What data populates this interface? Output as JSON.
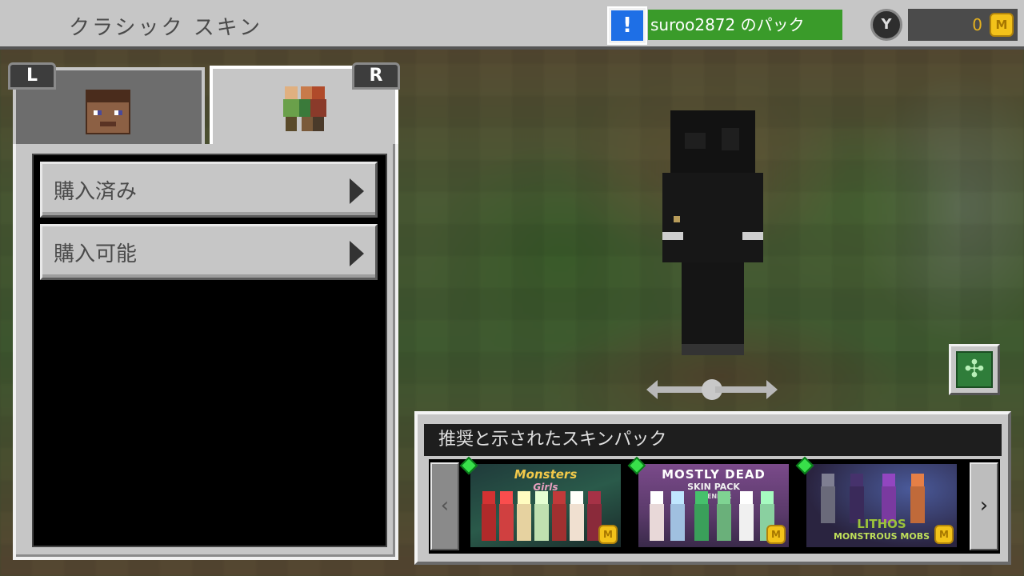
{
  "header": {
    "title": "クラシック スキン",
    "notify_icon": "!",
    "pack_label": "suroo2872 のパック",
    "y_button": "Y",
    "coins": "0",
    "coin_icon": "M"
  },
  "shoulder_buttons": {
    "left": "L",
    "right": "R"
  },
  "tabs": [
    {
      "id": "skin",
      "icon": "steve-face-icon"
    },
    {
      "id": "packs",
      "icon": "skin-pack-figures-icon"
    }
  ],
  "menu": [
    {
      "label": "購入済み"
    },
    {
      "label": "購入可能"
    }
  ],
  "preview": {
    "rotate_control": "rotate-arrows-icon",
    "fullscreen_icon": "expand-icon"
  },
  "recommended": {
    "title": "推奨と示されたスキンパック",
    "prev_arrow": "‹",
    "next_arrow": "›",
    "packs": [
      {
        "title": "Monsters",
        "title2": "Girls",
        "colors": {
          "bg": "#1f3a3a",
          "accent": "#8a2020"
        }
      },
      {
        "title": "MOSTLY DEAD",
        "title2": "SKIN PACK",
        "title3": "BY ENDER",
        "colors": {
          "bg": "#5a3a6a",
          "accent": "#3aa05a"
        }
      },
      {
        "title": "LITHOS",
        "title2": "MONSTROUS MOBS",
        "colors": {
          "bg": "#2a2440",
          "accent": "#9bc23a"
        }
      }
    ]
  },
  "colors": {
    "topbar": "#c6c6c6",
    "pack_label_green": "#3a9b2a",
    "notify_blue": "#1e6fe6",
    "coin_gold": "#f3c21a"
  }
}
